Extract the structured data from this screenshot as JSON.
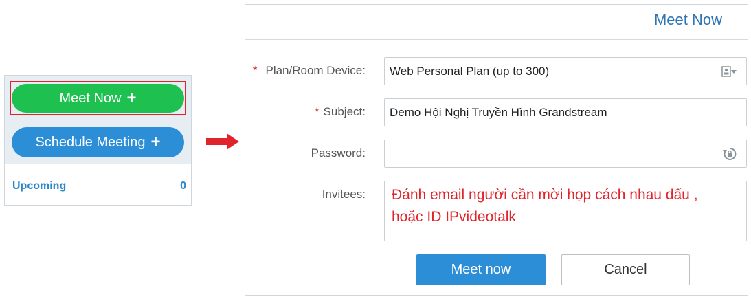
{
  "sidebar": {
    "meet_now_label": "Meet Now",
    "schedule_label": "Schedule Meeting",
    "plus_symbol": "+",
    "upcoming_label": "Upcoming",
    "upcoming_count": "0"
  },
  "dialog": {
    "title": "Meet Now",
    "required_mark": "*",
    "plan": {
      "label": "Plan/Room Device:",
      "value": "Web Personal Plan (up to 300)",
      "icon": "contact-card-dropdown-icon"
    },
    "subject": {
      "label": "Subject:",
      "value": "Demo Hội Nghị Truyền Hình Grandstream"
    },
    "password": {
      "label": "Password:",
      "value": "",
      "icon": "lock-refresh-icon"
    },
    "invitees": {
      "label": "Invitees:",
      "value": "Đánh email người cần mời họp cách nhau dấu , hoặc ID IPvideotalk"
    },
    "meet_now_button": "Meet now",
    "cancel_button": "Cancel"
  },
  "colors": {
    "green": "#1ec050",
    "blue": "#2d8ed8",
    "red": "#e0242b",
    "title_blue": "#2f75b3"
  }
}
